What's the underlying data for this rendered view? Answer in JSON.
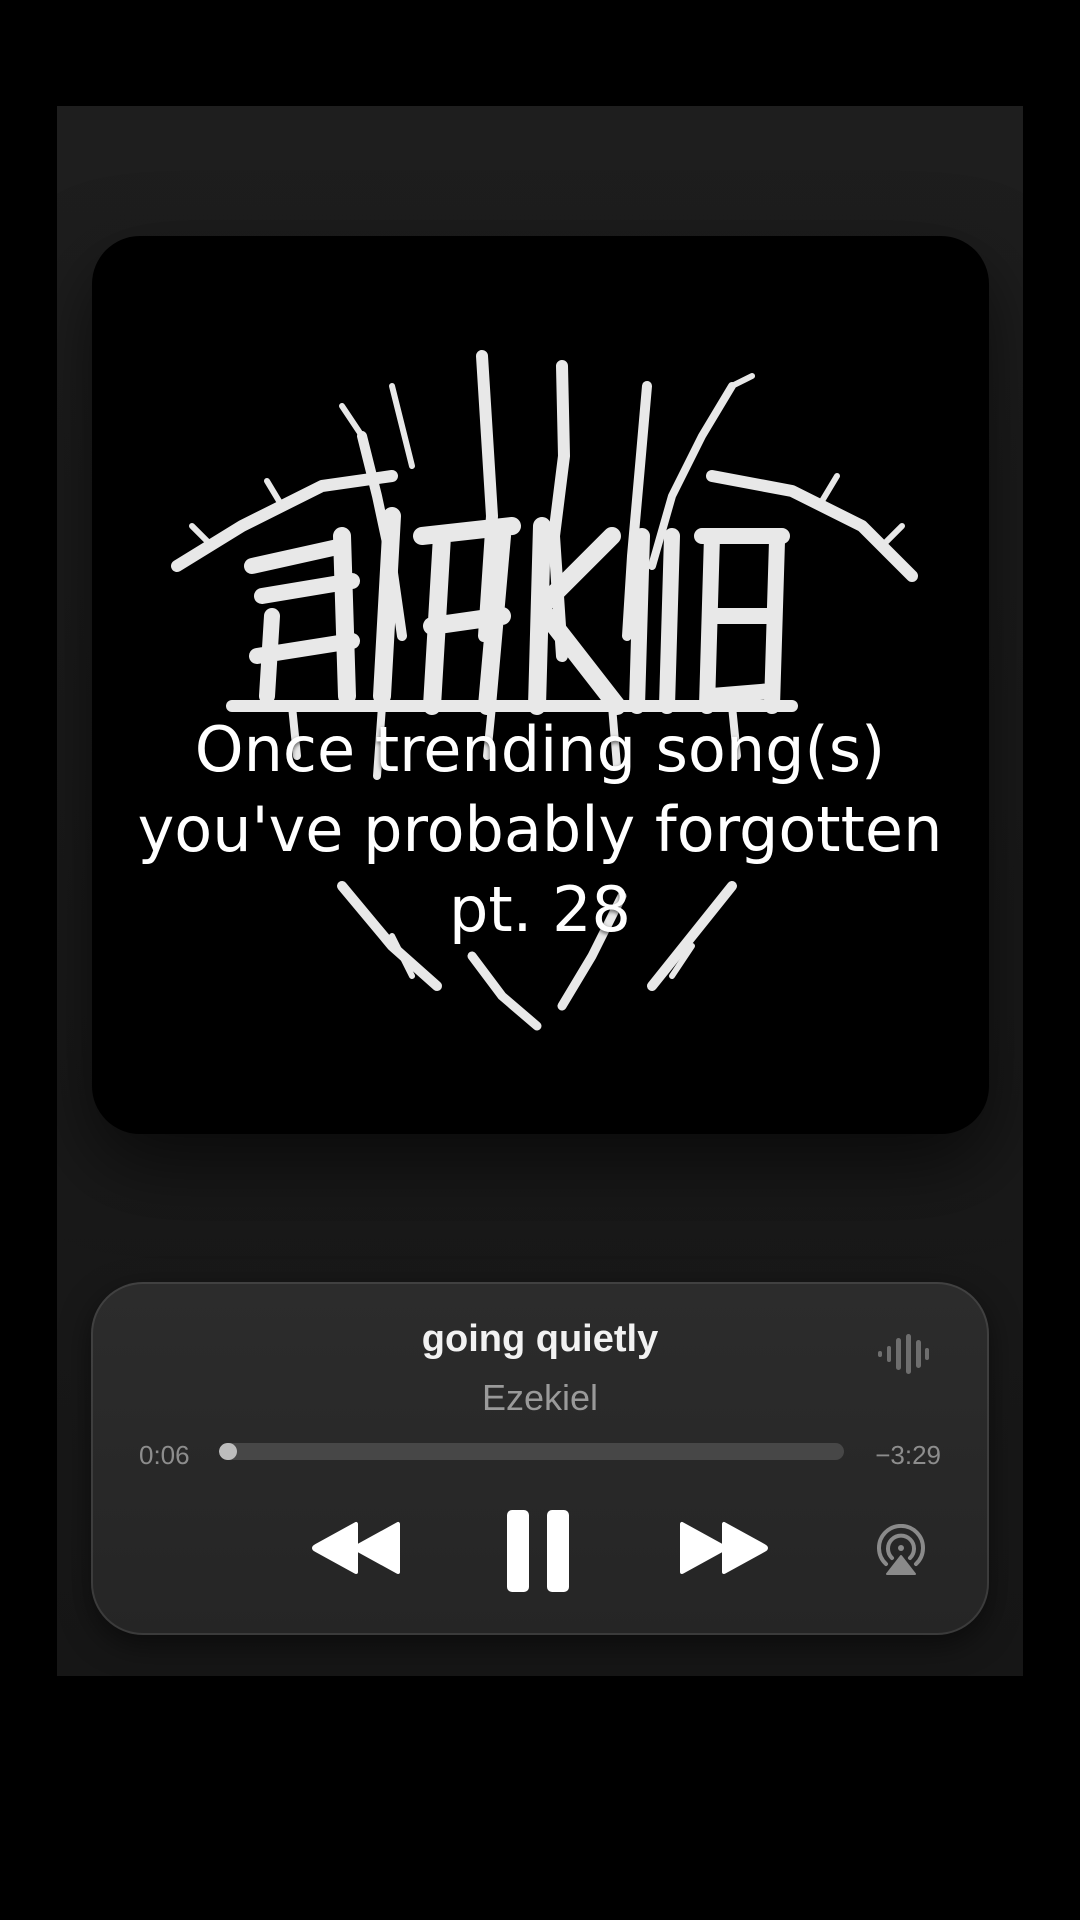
{
  "overlay_caption": {
    "line1": "Once trending song(s)",
    "line2": "you've probably forgotten",
    "line3": "pt. 28"
  },
  "album_art": {
    "logo_text": "Ezekiel",
    "icon": "metal-logo-artwork"
  },
  "now_playing": {
    "title": "going quietly",
    "artist": "Ezekiel",
    "elapsed": "0:06",
    "remaining": "−3:29",
    "progress_fraction": 0.029
  },
  "controls": {
    "rewind_icon": "rewind-icon",
    "pause_icon": "pause-icon",
    "forward_icon": "fast-forward-icon",
    "airplay_icon": "airplay-icon",
    "waveform_icon": "waveform-icon"
  },
  "colors": {
    "background": "#000000",
    "panel": "#1c1c1c",
    "player": "#282828",
    "text_primary": "#f2f2f2",
    "text_secondary": "#9a9a9a",
    "progress_fill": "#bdbdbd"
  }
}
